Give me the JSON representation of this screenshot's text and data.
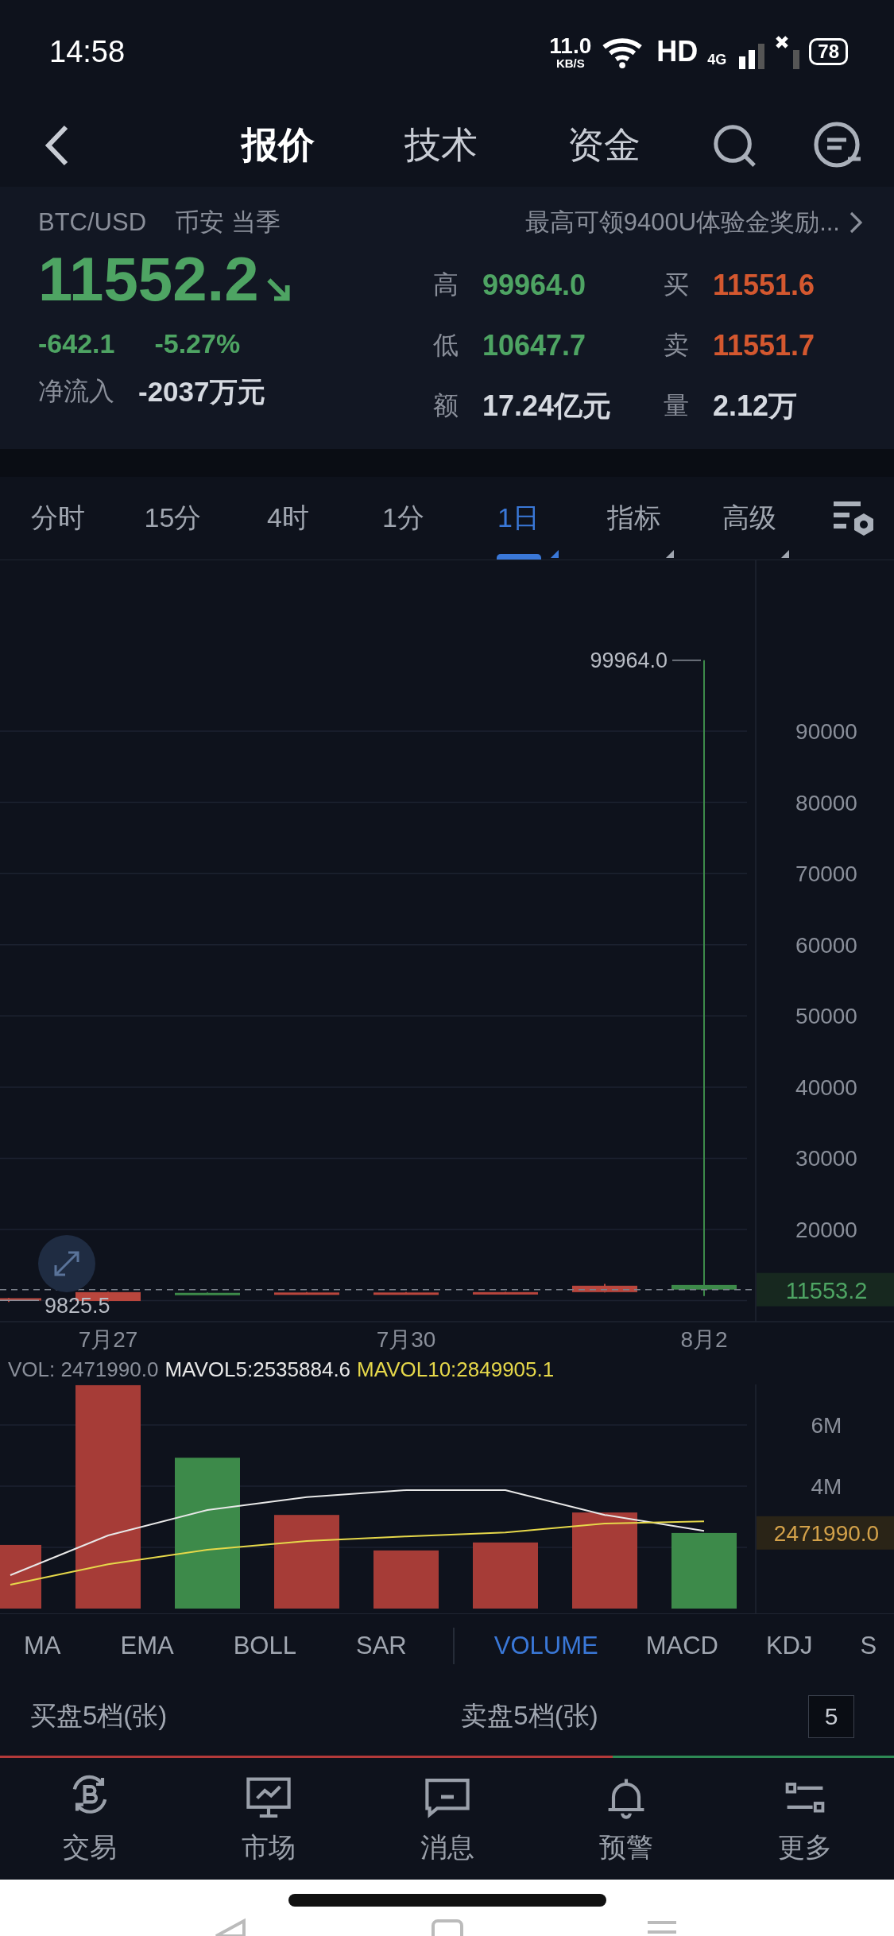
{
  "status_bar": {
    "time": "14:58",
    "network_speed": "11.0",
    "speed_unit": "KB/S",
    "hd": "HD",
    "network": "4G",
    "battery": "78"
  },
  "nav": {
    "tabs": [
      {
        "label": "报价",
        "selected": true
      },
      {
        "label": "技术",
        "selected": false
      },
      {
        "label": "资金",
        "selected": false
      }
    ]
  },
  "quote": {
    "symbol": "BTC/USD",
    "exchange": "币安 当季",
    "promo": "最高可领9400U体验金奖励...",
    "price": "11552.2",
    "falling": true,
    "change": "-642.1",
    "change_pct": "-5.27%",
    "net_inflow_label": "净流入",
    "net_inflow": "-2037万元",
    "stats": [
      {
        "label": "高",
        "value": "99964.0",
        "color": "#4ea463"
      },
      {
        "label": "买",
        "value": "11551.6",
        "color": "#d4582f"
      },
      {
        "label": "低",
        "value": "10647.7",
        "color": "#4ea463"
      },
      {
        "label": "卖",
        "value": "11551.7",
        "color": "#d4582f"
      },
      {
        "label": "额",
        "value": "17.24亿元",
        "color": "#d5d9e0"
      },
      {
        "label": "量",
        "value": "2.12万",
        "color": "#d5d9e0"
      }
    ]
  },
  "periods": [
    {
      "label": "分时",
      "selected": false,
      "dropdown": false
    },
    {
      "label": "15分",
      "selected": false,
      "dropdown": false
    },
    {
      "label": "4时",
      "selected": false,
      "dropdown": false
    },
    {
      "label": "1分",
      "selected": false,
      "dropdown": false
    },
    {
      "label": "1日",
      "selected": true,
      "dropdown": true
    },
    {
      "label": "指标",
      "selected": false,
      "dropdown": true
    },
    {
      "label": "高级",
      "selected": false,
      "dropdown": true
    }
  ],
  "price_chart": {
    "axis_labels": [
      "90000",
      "80000",
      "70000",
      "60000",
      "50000",
      "40000",
      "30000",
      "20000"
    ],
    "date_labels": [
      "7月27",
      "7月30",
      "8月2"
    ],
    "high_label": "99964.0",
    "low_label": "9825.5",
    "last_price": "11553.2",
    "candles": [
      {
        "rising": true
      },
      {
        "rising": true
      },
      {
        "rising": false
      },
      {
        "rising": true
      },
      {
        "rising": true
      },
      {
        "rising": true
      },
      {
        "rising": true
      },
      {
        "rising": false
      }
    ]
  },
  "volume_chart": {
    "legend": [
      {
        "label": "VOL: 2471990.0",
        "color": "#8a8f9a"
      },
      {
        "label": "MAVOL5:2535884.6",
        "color": "#e8e8e8"
      },
      {
        "label": "MAVOL10:2849905.1",
        "color": "#e6d84a"
      }
    ],
    "axis_labels": [
      "6M",
      "4M"
    ],
    "last_volume": "2471990.0"
  },
  "indicators": {
    "main": [
      {
        "label": "MA",
        "selected": false
      },
      {
        "label": "EMA",
        "selected": false
      },
      {
        "label": "BOLL",
        "selected": false
      },
      {
        "label": "SAR",
        "selected": false
      }
    ],
    "sub": [
      {
        "label": "VOLUME",
        "selected": true
      },
      {
        "label": "MACD",
        "selected": false
      },
      {
        "label": "KDJ",
        "selected": false
      },
      {
        "label": "S",
        "selected": false
      }
    ]
  },
  "order_book": {
    "bid_label": "买盘5档(张)",
    "ask_label": "卖盘5档(张)",
    "depth": "5",
    "ratio": {
      "level": 0.685
    }
  },
  "bottom_nav": [
    {
      "label": "交易",
      "kind": "coin"
    },
    {
      "label": "市场",
      "kind": "monitor"
    },
    {
      "label": "消息",
      "kind": "message"
    },
    {
      "label": "预警",
      "kind": "bell"
    },
    {
      "label": "更多",
      "kind": "sliders"
    }
  ]
}
